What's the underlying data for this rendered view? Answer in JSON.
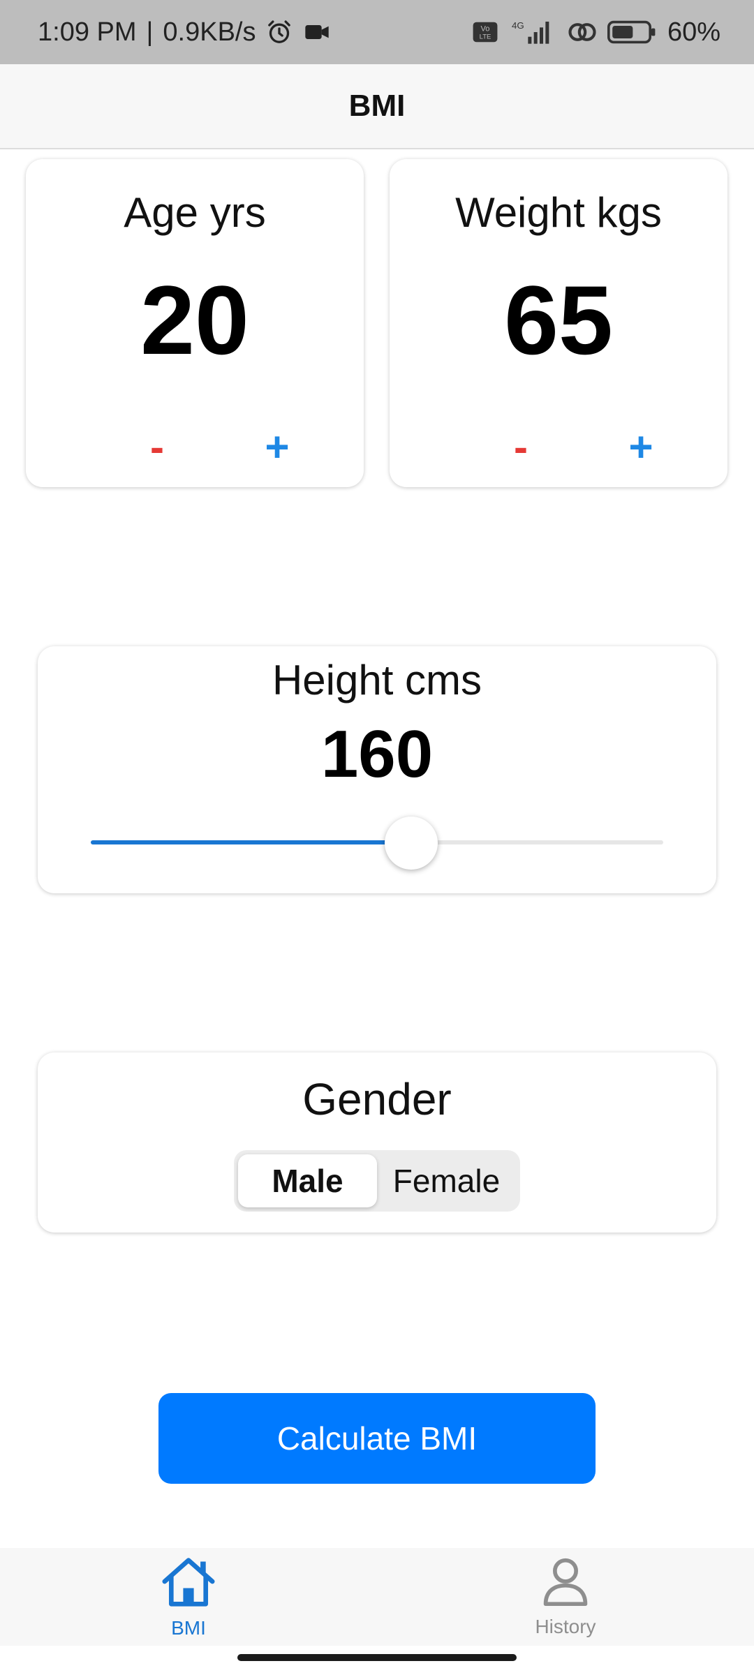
{
  "status_bar": {
    "time": "1:09 PM",
    "network_speed": "0.9KB/s",
    "battery_percent": "60%",
    "icons": [
      "alarm-icon",
      "video-camera-icon",
      "volte-icon",
      "4g-signal-icon",
      "hotspot-icon",
      "battery-icon"
    ],
    "battery_level": 0.6
  },
  "app_bar": {
    "title": "BMI"
  },
  "age": {
    "label": "Age yrs",
    "value": "20",
    "minus": "-",
    "plus": "+"
  },
  "weight": {
    "label": "Weight kgs",
    "value": "65",
    "minus": "-",
    "plus": "+"
  },
  "height": {
    "label": "Height cms",
    "value": "160",
    "slider_fraction": 0.56
  },
  "gender": {
    "label": "Gender",
    "options": [
      "Male",
      "Female"
    ],
    "selected": "Male"
  },
  "cta": {
    "label": "Calculate BMI"
  },
  "bottom_nav": {
    "items": [
      {
        "label": "BMI",
        "icon": "home-icon",
        "active": true
      },
      {
        "label": "History",
        "icon": "person-icon",
        "active": false
      }
    ]
  },
  "colors": {
    "accent": "#007aff",
    "nav_active": "#1976d2",
    "minus": "#e53935",
    "plus": "#1e88e5"
  }
}
